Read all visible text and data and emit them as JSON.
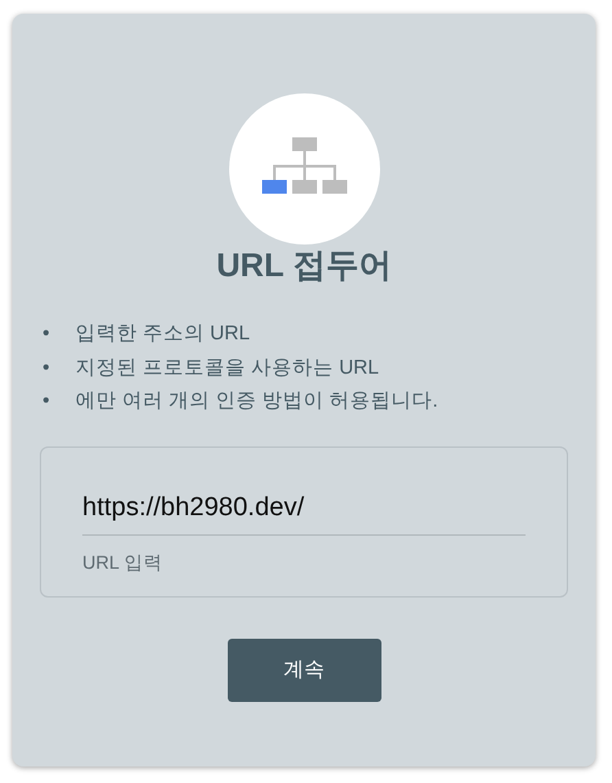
{
  "title": "URL 접두어",
  "bullets": [
    {
      "marker": "•",
      "text": "입력한 주소의 URL"
    },
    {
      "marker": "•",
      "text": "지정된 프로토콜을 사용하는 URL"
    },
    {
      "marker": "•",
      "text": "에만 여러 개의 인증 방법이 허용됩니다."
    }
  ],
  "field": {
    "value": "https://bh2980.dev/",
    "hint": "URL 입력"
  },
  "button": "계속"
}
